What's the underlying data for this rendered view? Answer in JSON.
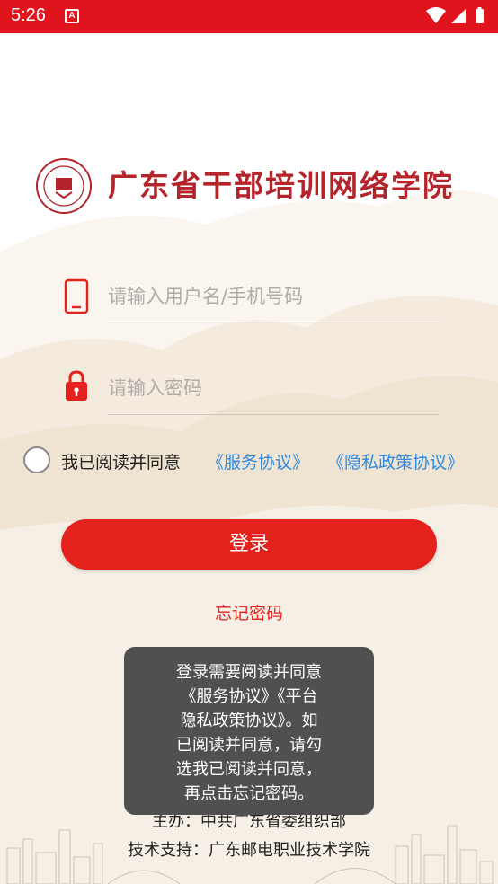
{
  "status_bar": {
    "time": "5:26",
    "notif_icon": "A"
  },
  "logo": {
    "text": "广东省干部培训网络学院"
  },
  "username": {
    "placeholder": "请输入用户名/手机号码",
    "value": ""
  },
  "password": {
    "placeholder": "请输入密码",
    "value": ""
  },
  "agreement": {
    "checked": false,
    "text": "我已阅读并同意",
    "service_link": "《服务协议》",
    "privacy_link": "《隐私政策协议》"
  },
  "login_button": "登录",
  "forgot_password": "忘记密码",
  "footer": {
    "host": "主办：中共广东省委组织部",
    "tech": "技术支持：广东邮电职业技术学院"
  },
  "toast": {
    "lines": [
      "登录需要阅读并同意",
      "《服务协议》《平台",
      "隐私政策协议》。如",
      "已阅读并同意，请勾",
      "选我已阅读并同意，",
      "再点击忘记密码。"
    ]
  },
  "colors": {
    "brand_red": "#e3221e",
    "link_blue": "#2d8ae0",
    "status_bar": "#e0141c"
  }
}
